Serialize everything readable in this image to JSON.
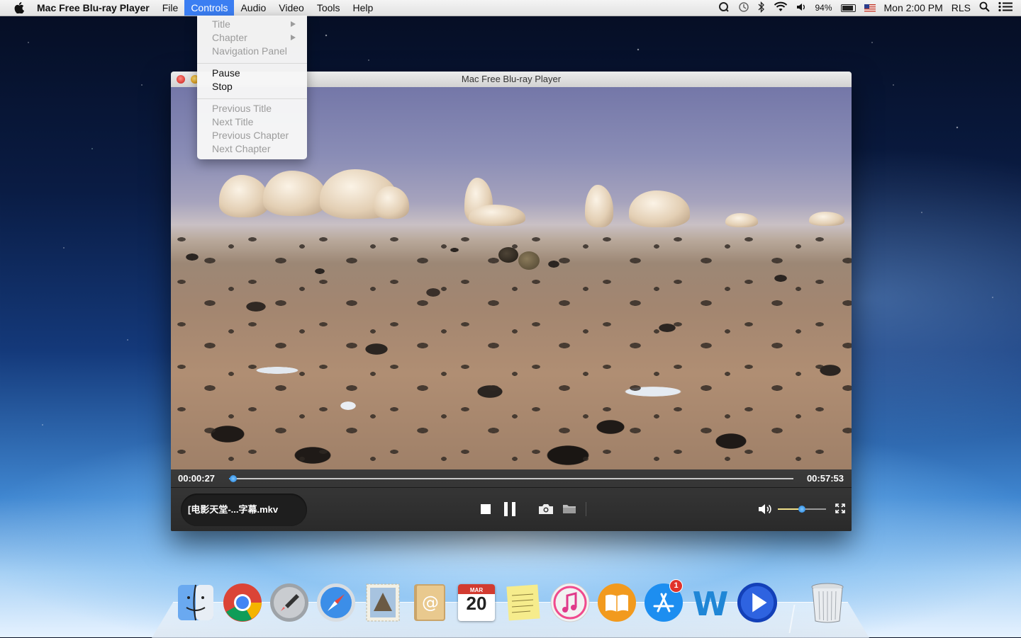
{
  "menubar": {
    "app_name": "Mac Free Blu-ray Player",
    "menus": [
      "File",
      "Controls",
      "Audio",
      "Video",
      "Tools",
      "Help"
    ],
    "active_menu": "Controls",
    "battery": "94%",
    "clock": "Mon 2:00 PM",
    "user": "RLS"
  },
  "controls_menu": {
    "group1": [
      {
        "label": "Title",
        "enabled": false,
        "submenu": true
      },
      {
        "label": "Chapter",
        "enabled": false,
        "submenu": true
      },
      {
        "label": "Navigation Panel",
        "enabled": false,
        "submenu": false
      }
    ],
    "group2": [
      {
        "label": "Pause",
        "enabled": true
      },
      {
        "label": "Stop",
        "enabled": true
      }
    ],
    "group3": [
      {
        "label": "Previous Title",
        "enabled": false
      },
      {
        "label": "Next Title",
        "enabled": false
      },
      {
        "label": "Previous Chapter",
        "enabled": false
      },
      {
        "label": "Next Chapter",
        "enabled": false
      }
    ]
  },
  "window": {
    "title": "Mac Free Blu-ray Player"
  },
  "player": {
    "current_time": "00:00:27",
    "total_time": "00:57:53",
    "progress": 0.008,
    "file_name": "[电影天堂-...字幕.mkv",
    "volume": 0.5
  },
  "dock": {
    "apps": [
      {
        "name": "finder",
        "icon": "finder-icon"
      },
      {
        "name": "chrome",
        "icon": "chrome-icon"
      },
      {
        "name": "launchpad",
        "icon": "rocket-icon"
      },
      {
        "name": "safari",
        "icon": "compass-icon"
      },
      {
        "name": "mail",
        "icon": "mail-stamp-icon"
      },
      {
        "name": "contacts",
        "icon": "address-book-icon"
      },
      {
        "name": "calendar",
        "icon": "calendar-icon",
        "month": "MAR",
        "day": "20"
      },
      {
        "name": "notes",
        "icon": "notes-icon"
      },
      {
        "name": "itunes",
        "icon": "music-note-icon"
      },
      {
        "name": "ibooks",
        "icon": "book-icon"
      },
      {
        "name": "app-store",
        "icon": "app-store-icon",
        "badge": "1"
      },
      {
        "name": "word",
        "icon": "word-icon"
      },
      {
        "name": "blu-ray-player",
        "icon": "play-icon"
      },
      {
        "name": "trash",
        "icon": "trash-icon"
      }
    ]
  },
  "colors": {
    "menu_highlight": "#3b7ef2",
    "progress_accent": "#3fa2ff",
    "badge_red": "#e0322a"
  }
}
